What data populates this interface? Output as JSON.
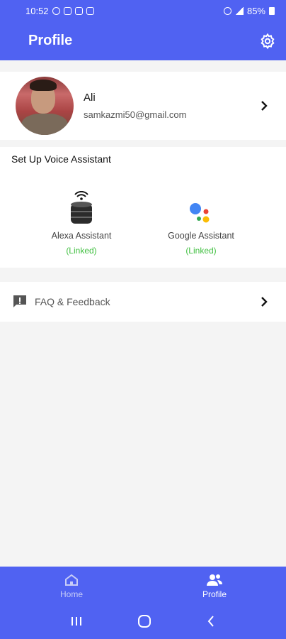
{
  "statusbar": {
    "time": "10:52",
    "battery": "85%"
  },
  "header": {
    "title": "Profile"
  },
  "profile": {
    "name": "Ali",
    "email": "samkazmi50@gmail.com"
  },
  "voice": {
    "section_title": "Set Up Voice Assistant",
    "assistants": [
      {
        "name": "Alexa Assistant",
        "status": "(Linked)"
      },
      {
        "name": "Google Assistant",
        "status": "(Linked)"
      }
    ]
  },
  "faq": {
    "label": "FAQ & Feedback"
  },
  "nav": {
    "items": [
      {
        "label": "Home",
        "icon": "home-icon"
      },
      {
        "label": "Profile",
        "icon": "people-icon"
      }
    ]
  },
  "colors": {
    "primary": "#5062f2",
    "linked": "#3fbf3f",
    "background": "#f4f4f4"
  }
}
